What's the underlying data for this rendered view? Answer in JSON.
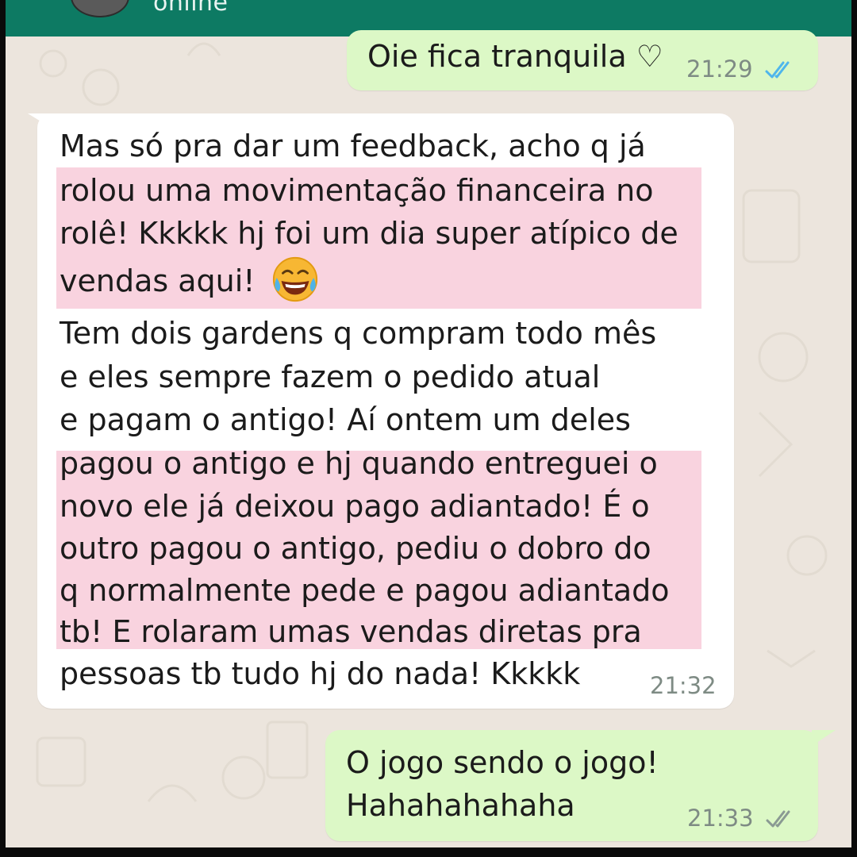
{
  "header": {
    "status": "online"
  },
  "messages": [
    {
      "id": "msg1",
      "direction": "outgoing",
      "lines": [
        "Oie fica tranquila ♡"
      ],
      "time": "21:29",
      "ticks": "read"
    },
    {
      "id": "msg2",
      "direction": "incoming",
      "lines": [
        "Mas só pra dar um feedback, acho q já",
        "rolou uma movimentação financeira no",
        "rolê! Kkkkk hj foi um dia super atípico de",
        "vendas aqui!",
        "Tem dois gardens q compram todo mês",
        "e eles sempre fazem o pedido atual",
        "e pagam o antigo! Aí ontem um deles",
        "pagou o antigo e hj quando entreguei o",
        "novo ele já deixou pago adiantado! É o",
        "outro pagou o antigo, pediu o dobro do",
        "q normalmente pede e pagou adiantado",
        "tb! E rolaram umas vendas diretas pra",
        "pessoas tb tudo hj do nada! Kkkkk"
      ],
      "emoji": "tears-of-joy",
      "time": "21:32"
    },
    {
      "id": "msg3",
      "direction": "outgoing",
      "lines": [
        "O jogo sendo o jogo!",
        "Hahahahahaha"
      ],
      "time": "21:33",
      "ticks": "delivered"
    }
  ],
  "colors": {
    "header": "#0d7a63",
    "chat_background": "#ece5dd",
    "outgoing_bubble": "#dcf8c6",
    "incoming_bubble": "#ffffff",
    "highlight": "#f9d3df",
    "read_ticks": "#4fb6ec",
    "delivered_ticks": "#8a9a93"
  }
}
